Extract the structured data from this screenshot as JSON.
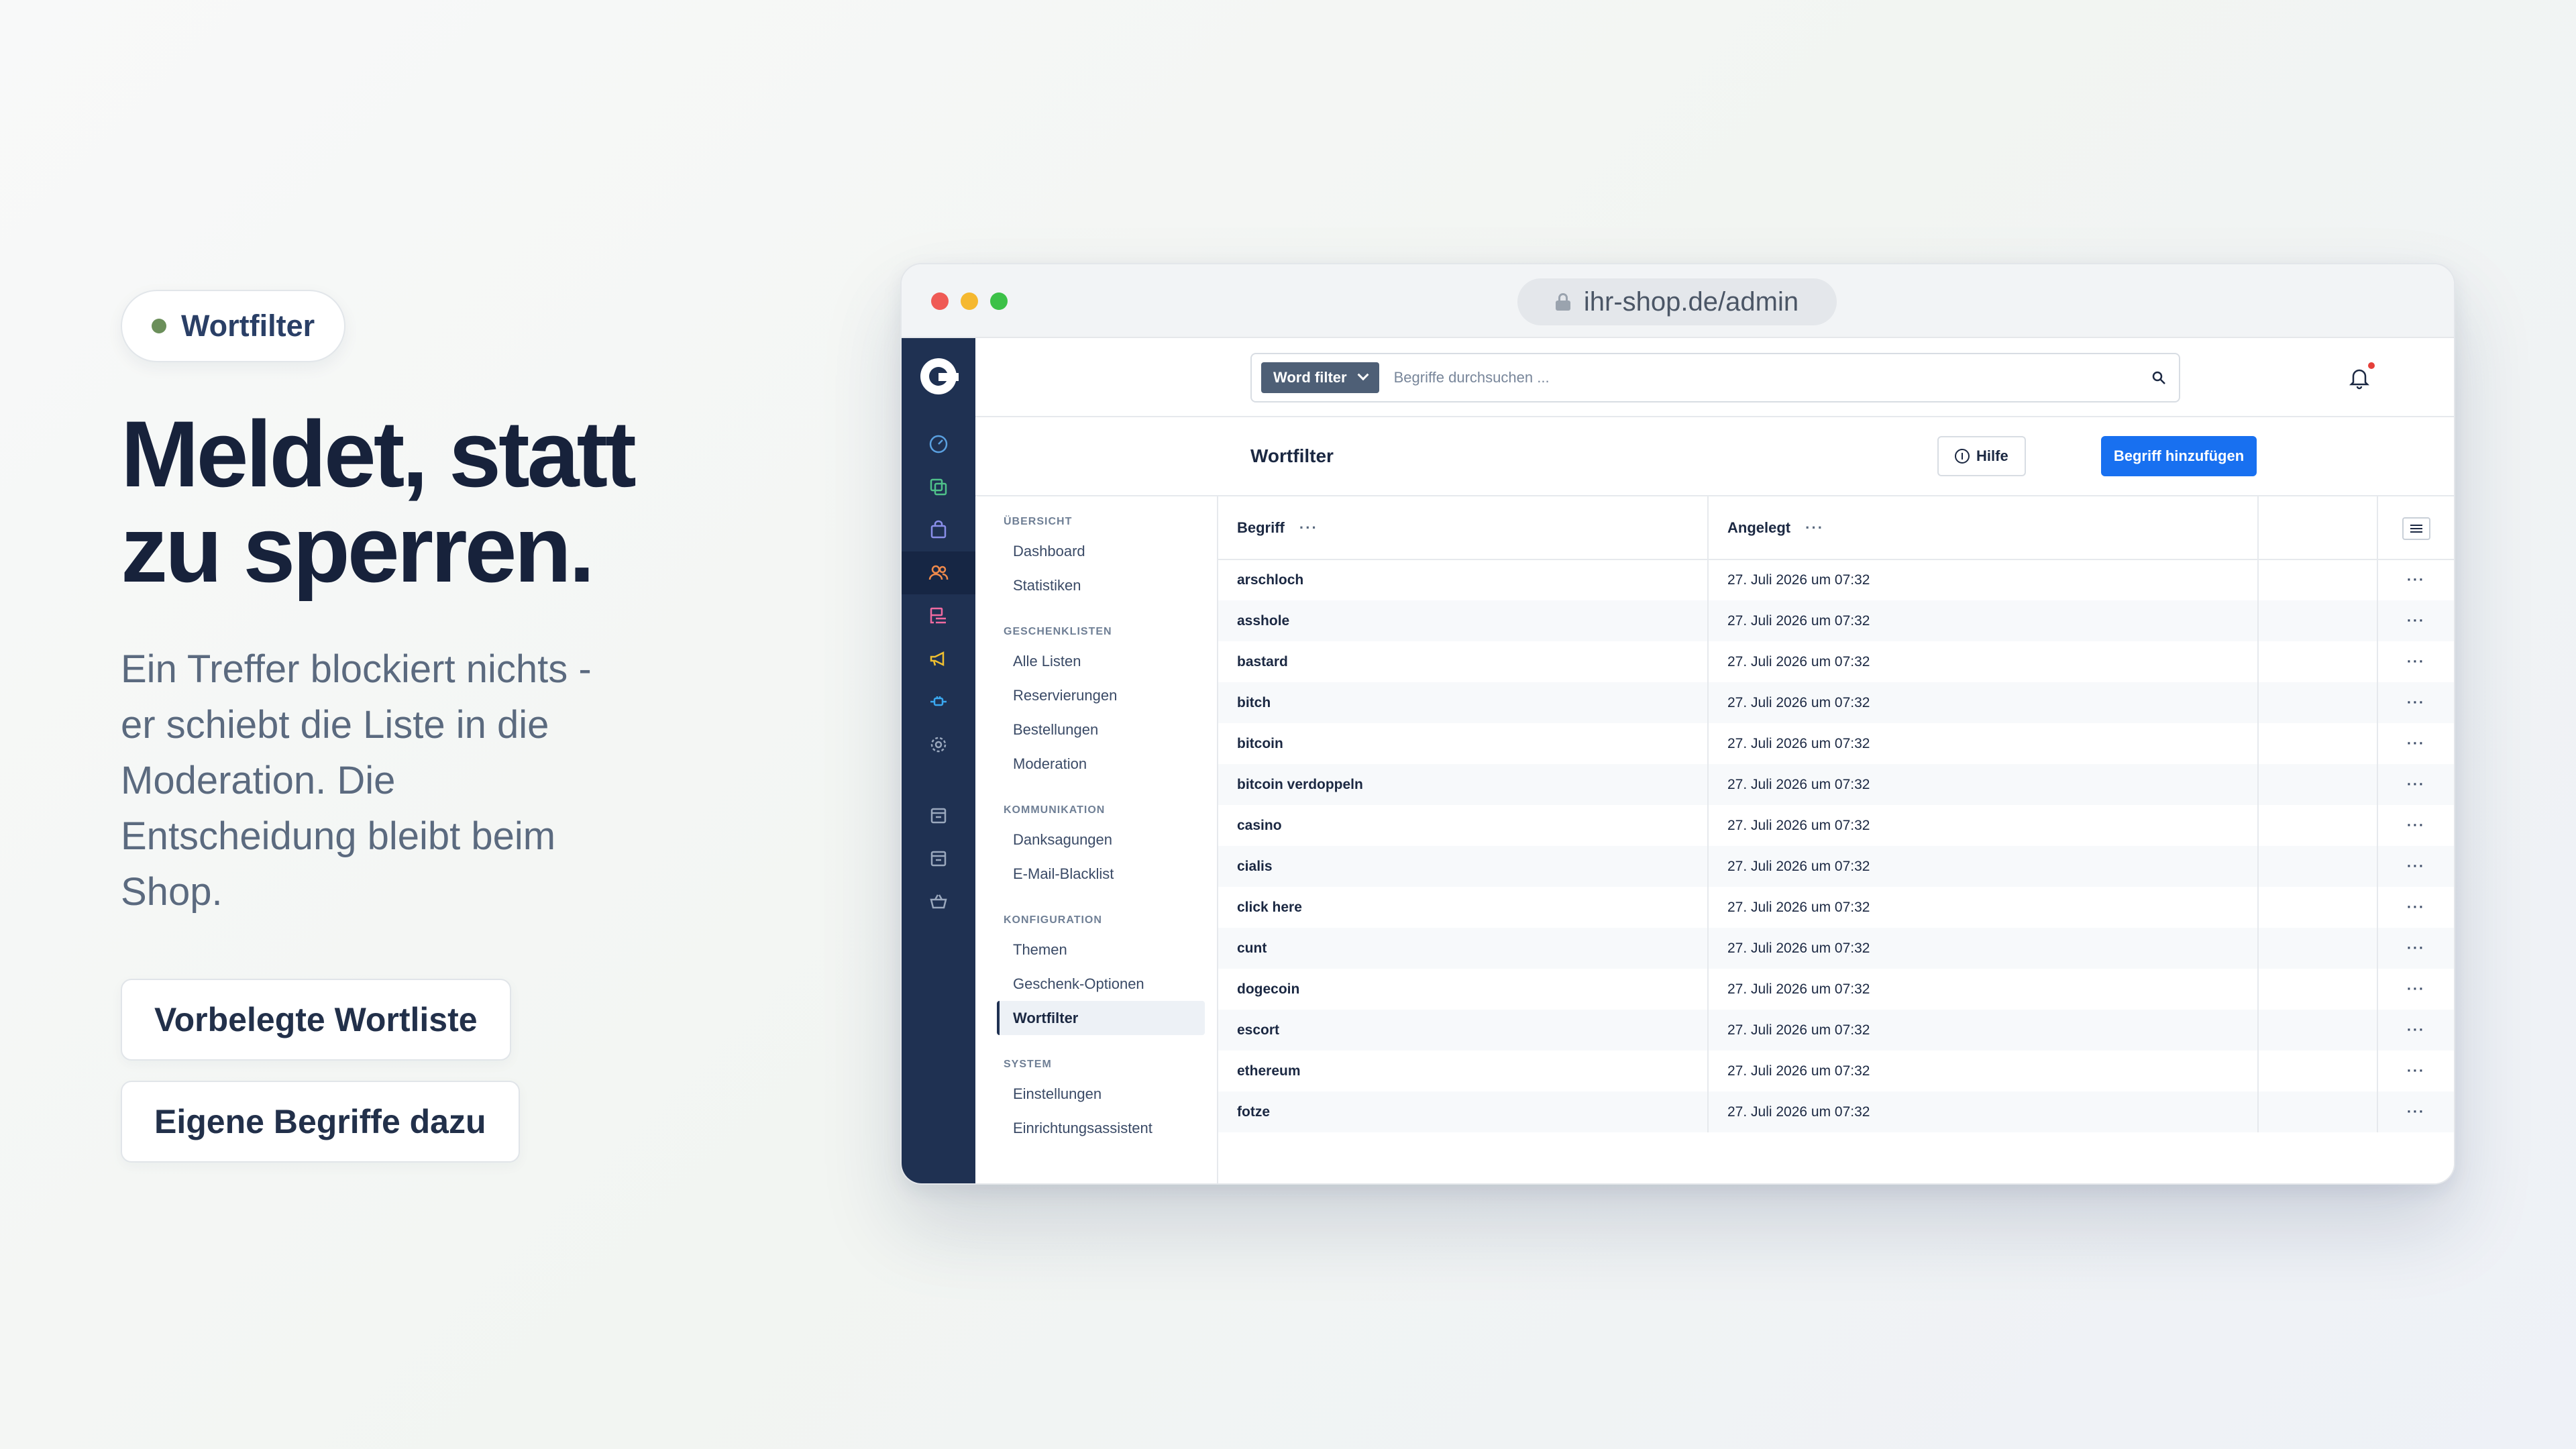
{
  "hero": {
    "badge": "Wortfilter",
    "badge_color": "#6b8f5a",
    "headline_line1": "Meldet, statt",
    "headline_line2": "zu sperren.",
    "subline": "Ein Treffer blockiert nichts - er schiebt die Liste in die Moderation. Die Entscheidung bleibt beim Shop.",
    "features": [
      "Vorbelegte Wortliste",
      "Eigene Begriffe dazu"
    ]
  },
  "browser": {
    "url": "ihr-shop.de/admin",
    "url_icon": "lock-icon"
  },
  "rail": {
    "logo": "brand-logo",
    "items": [
      {
        "icon": "dashboard-gauge-icon",
        "color": "#5aa0e0"
      },
      {
        "icon": "catalog-copy-icon",
        "color": "#4fc18a"
      },
      {
        "icon": "orders-bag-icon",
        "color": "#8a8fea"
      },
      {
        "icon": "customers-users-icon",
        "color": "#f08a4b",
        "active": true
      },
      {
        "icon": "content-list-icon",
        "color": "#f06aa0"
      },
      {
        "icon": "marketing-megaphone-icon",
        "color": "#f0c030"
      },
      {
        "icon": "extensions-plug-icon",
        "color": "#3aa8f0"
      },
      {
        "icon": "settings-gear-icon",
        "color": "#9aa8bd"
      },
      {
        "icon": "sales-channel-store-icon",
        "color": "#9aa8bd"
      },
      {
        "icon": "sales-channel-store-2-icon",
        "color": "#9aa8bd"
      },
      {
        "icon": "sales-channel-basket-icon",
        "color": "#9aa8bd"
      }
    ]
  },
  "topbar": {
    "scope_label": "Word filter",
    "search_placeholder": "Begriffe durchsuchen ..."
  },
  "page": {
    "title": "Wortfilter",
    "help_label": "Hilfe",
    "add_label": "Begriff hinzufügen",
    "accent": "#1870f0"
  },
  "subnav": [
    {
      "heading": "ÜBERSICHT",
      "items": [
        {
          "label": "Dashboard"
        },
        {
          "label": "Statistiken"
        }
      ]
    },
    {
      "heading": "GESCHENKLISTEN",
      "items": [
        {
          "label": "Alle Listen"
        },
        {
          "label": "Reservierungen"
        },
        {
          "label": "Bestellungen"
        },
        {
          "label": "Moderation"
        }
      ]
    },
    {
      "heading": "KOMMUNIKATION",
      "items": [
        {
          "label": "Danksagungen"
        },
        {
          "label": "E-Mail-Blacklist"
        }
      ]
    },
    {
      "heading": "KONFIGURATION",
      "items": [
        {
          "label": "Themen"
        },
        {
          "label": "Geschenk-Optionen"
        },
        {
          "label": "Wortfilter",
          "active": true
        }
      ]
    },
    {
      "heading": "SYSTEM",
      "items": [
        {
          "label": "Einstellungen"
        },
        {
          "label": "Einrichtungsassistent"
        }
      ]
    }
  ],
  "table": {
    "columns": [
      "Begriff",
      "Angelegt"
    ],
    "header_more": "···",
    "row_more": "···",
    "rows": [
      {
        "term": "arschloch",
        "created": "27. Juli 2026 um 07:32"
      },
      {
        "term": "asshole",
        "created": "27. Juli 2026 um 07:32"
      },
      {
        "term": "bastard",
        "created": "27. Juli 2026 um 07:32"
      },
      {
        "term": "bitch",
        "created": "27. Juli 2026 um 07:32"
      },
      {
        "term": "bitcoin",
        "created": "27. Juli 2026 um 07:32"
      },
      {
        "term": "bitcoin verdoppeln",
        "created": "27. Juli 2026 um 07:32"
      },
      {
        "term": "casino",
        "created": "27. Juli 2026 um 07:32"
      },
      {
        "term": "cialis",
        "created": "27. Juli 2026 um 07:32"
      },
      {
        "term": "click here",
        "created": "27. Juli 2026 um 07:32"
      },
      {
        "term": "cunt",
        "created": "27. Juli 2026 um 07:32"
      },
      {
        "term": "dogecoin",
        "created": "27. Juli 2026 um 07:32"
      },
      {
        "term": "escort",
        "created": "27. Juli 2026 um 07:32"
      },
      {
        "term": "ethereum",
        "created": "27. Juli 2026 um 07:32"
      },
      {
        "term": "fotze",
        "created": "27. Juli 2026 um 07:32"
      }
    ]
  }
}
